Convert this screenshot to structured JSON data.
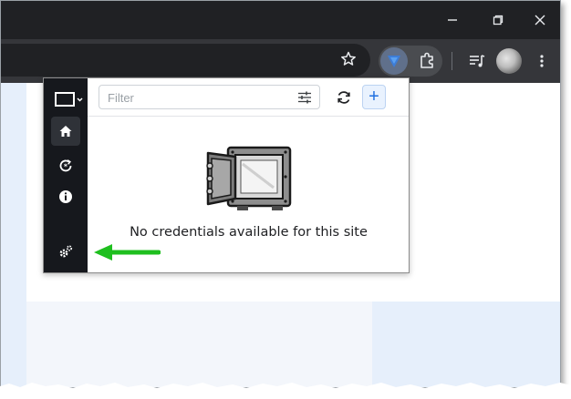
{
  "popup": {
    "filter_placeholder": "Filter",
    "add_label": "+",
    "empty_message": "No credentials available for this site"
  },
  "colors": {
    "titlebar": "#202124",
    "toolbar": "#35363a",
    "sidebar": "#16181d",
    "accent": "#1f6fe0",
    "annotation_arrow": "#1fbf1f"
  },
  "icons": {
    "window": [
      "minimize-icon",
      "maximize-icon",
      "close-icon"
    ],
    "toolbar": [
      "star-icon",
      "extension-active-icon",
      "puzzle-icon",
      "media-icon",
      "avatar",
      "menu-icon"
    ],
    "sidebar": [
      "vault-switch-icon",
      "home-icon",
      "recovery-icon",
      "info-icon",
      "settings-icon"
    ],
    "topbar": [
      "filter-settings-icon",
      "refresh-icon",
      "add-icon"
    ]
  }
}
